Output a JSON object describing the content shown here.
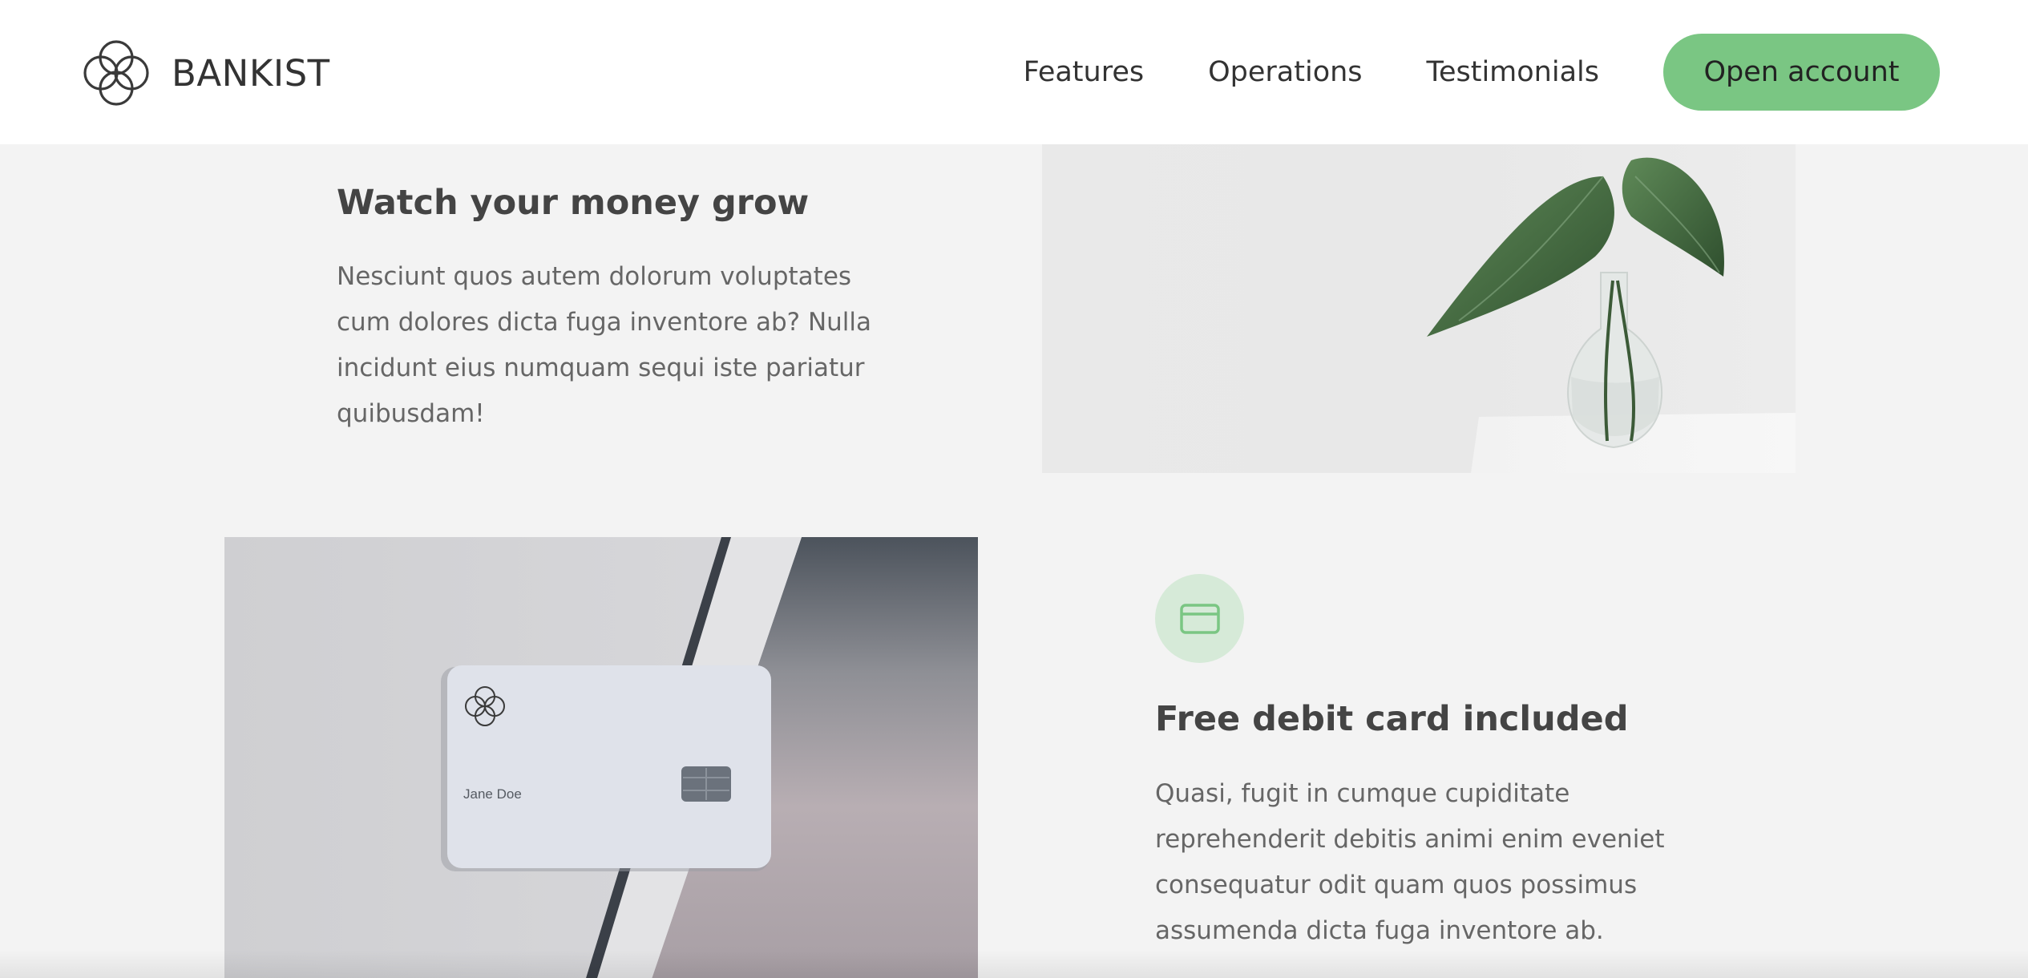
{
  "header": {
    "brand": "BANKIST",
    "nav": [
      "Features",
      "Operations",
      "Testimonials"
    ],
    "cta": "Open account"
  },
  "features": [
    {
      "icon": "trending-up-icon",
      "title": "Watch your money grow",
      "text": "Nesciunt quos autem dolorum voluptates cum dolores dicta fuga inventore ab? Nulla incidunt eius numquam sequi iste pariatur quibusdam!",
      "image": "plant-in-vase"
    },
    {
      "icon": "credit-card-icon",
      "title": "Free debit card included",
      "text": "Quasi, fugit in cumque cupiditate reprehenderit debitis animi enim eveniet consequatur odit quam quos possimus assumenda dicta fuga inventore ab.",
      "image": "debit-card",
      "card_holder": "Jane Doe"
    }
  ],
  "colors": {
    "accent": "#7ac683",
    "accent_light": "#d6ead8",
    "background": "#f3f3f3"
  }
}
